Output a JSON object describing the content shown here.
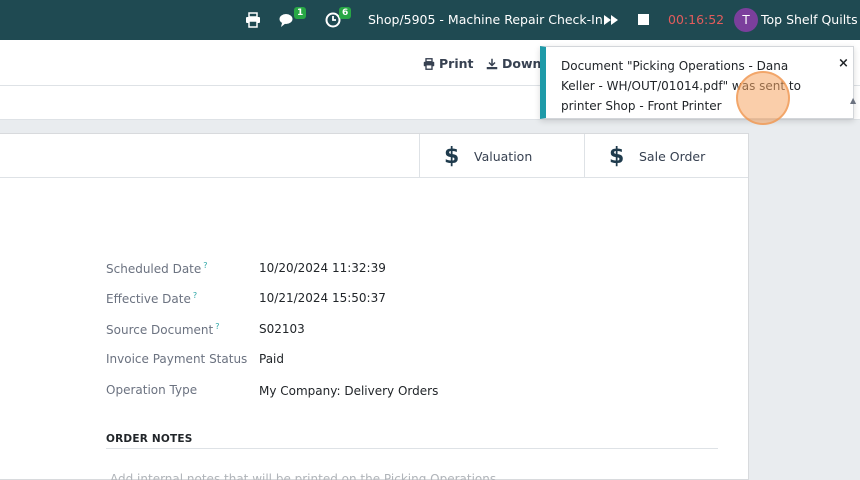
{
  "navbar": {
    "print_icon": "printer-icon",
    "chat_icon": "chat-icon",
    "chat_count": "1",
    "activity_icon": "clock-icon",
    "activity_count": "6",
    "title": "Shop/5905 - Machine Repair Check-In",
    "play_icon": "fast-forward-icon",
    "stop_icon": "stop-icon",
    "timer": "00:16:52",
    "avatar_letter": "T",
    "company": "Top Shelf Quilts"
  },
  "control_panel": {
    "print_label": "Print",
    "download_label": "Downlo"
  },
  "smart_buttons": [
    {
      "icon": "dollar-icon",
      "label": "Valuation"
    },
    {
      "icon": "dollar-icon",
      "label": "Sale Order"
    }
  ],
  "fields": [
    {
      "label": "Scheduled Date",
      "help": "?",
      "value": "10/20/2024 11:32:39"
    },
    {
      "label": "Effective Date",
      "help": "?",
      "value": "10/21/2024 15:50:37"
    },
    {
      "label": "Source Document",
      "help": "?",
      "value": "S02103"
    },
    {
      "label": "Invoice Payment Status",
      "help": "",
      "value": "Paid"
    },
    {
      "label": "Operation Type",
      "help": "",
      "value": "My Company: Delivery Orders"
    }
  ],
  "notes": {
    "title": "ORDER NOTES",
    "placeholder": "Add internal notes that will be printed on the Picking Operations"
  },
  "toast": {
    "message": "Document \"Picking Operations - Dana Keller - WH/OUT/01014.pdf\" was sent to printer Shop - Front Printer",
    "close": "×"
  },
  "colors": {
    "navbar_bg": "#1f4a52",
    "badge_green": "#28a745",
    "timer_red": "#e25c5c",
    "avatar_purple": "#7b3f9c",
    "toast_accent": "#1e9aa8"
  }
}
